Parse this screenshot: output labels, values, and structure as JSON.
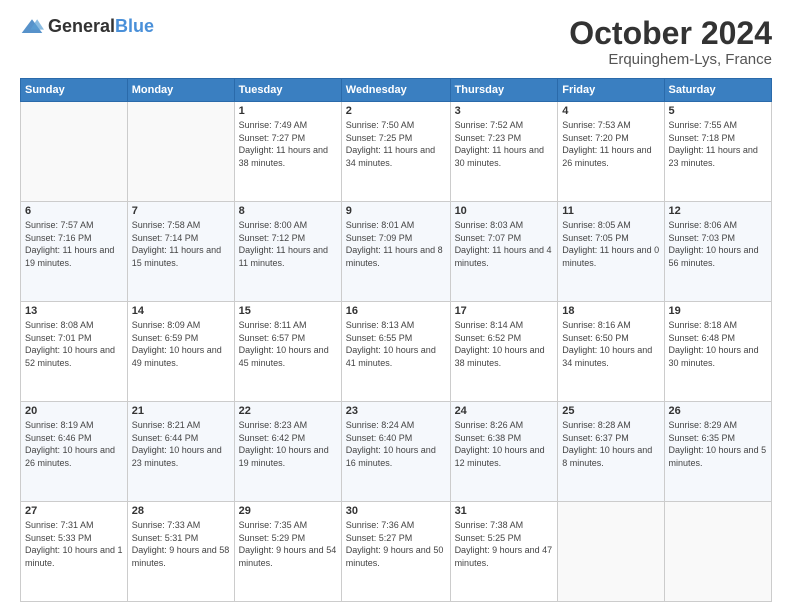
{
  "header": {
    "logo_general": "General",
    "logo_blue": "Blue",
    "month_title": "October 2024",
    "location": "Erquinghem-Lys, France"
  },
  "weekdays": [
    "Sunday",
    "Monday",
    "Tuesday",
    "Wednesday",
    "Thursday",
    "Friday",
    "Saturday"
  ],
  "weeks": [
    [
      {
        "day": "",
        "sunrise": "",
        "sunset": "",
        "daylight": ""
      },
      {
        "day": "",
        "sunrise": "",
        "sunset": "",
        "daylight": ""
      },
      {
        "day": "1",
        "sunrise": "Sunrise: 7:49 AM",
        "sunset": "Sunset: 7:27 PM",
        "daylight": "Daylight: 11 hours and 38 minutes."
      },
      {
        "day": "2",
        "sunrise": "Sunrise: 7:50 AM",
        "sunset": "Sunset: 7:25 PM",
        "daylight": "Daylight: 11 hours and 34 minutes."
      },
      {
        "day": "3",
        "sunrise": "Sunrise: 7:52 AM",
        "sunset": "Sunset: 7:23 PM",
        "daylight": "Daylight: 11 hours and 30 minutes."
      },
      {
        "day": "4",
        "sunrise": "Sunrise: 7:53 AM",
        "sunset": "Sunset: 7:20 PM",
        "daylight": "Daylight: 11 hours and 26 minutes."
      },
      {
        "day": "5",
        "sunrise": "Sunrise: 7:55 AM",
        "sunset": "Sunset: 7:18 PM",
        "daylight": "Daylight: 11 hours and 23 minutes."
      }
    ],
    [
      {
        "day": "6",
        "sunrise": "Sunrise: 7:57 AM",
        "sunset": "Sunset: 7:16 PM",
        "daylight": "Daylight: 11 hours and 19 minutes."
      },
      {
        "day": "7",
        "sunrise": "Sunrise: 7:58 AM",
        "sunset": "Sunset: 7:14 PM",
        "daylight": "Daylight: 11 hours and 15 minutes."
      },
      {
        "day": "8",
        "sunrise": "Sunrise: 8:00 AM",
        "sunset": "Sunset: 7:12 PM",
        "daylight": "Daylight: 11 hours and 11 minutes."
      },
      {
        "day": "9",
        "sunrise": "Sunrise: 8:01 AM",
        "sunset": "Sunset: 7:09 PM",
        "daylight": "Daylight: 11 hours and 8 minutes."
      },
      {
        "day": "10",
        "sunrise": "Sunrise: 8:03 AM",
        "sunset": "Sunset: 7:07 PM",
        "daylight": "Daylight: 11 hours and 4 minutes."
      },
      {
        "day": "11",
        "sunrise": "Sunrise: 8:05 AM",
        "sunset": "Sunset: 7:05 PM",
        "daylight": "Daylight: 11 hours and 0 minutes."
      },
      {
        "day": "12",
        "sunrise": "Sunrise: 8:06 AM",
        "sunset": "Sunset: 7:03 PM",
        "daylight": "Daylight: 10 hours and 56 minutes."
      }
    ],
    [
      {
        "day": "13",
        "sunrise": "Sunrise: 8:08 AM",
        "sunset": "Sunset: 7:01 PM",
        "daylight": "Daylight: 10 hours and 52 minutes."
      },
      {
        "day": "14",
        "sunrise": "Sunrise: 8:09 AM",
        "sunset": "Sunset: 6:59 PM",
        "daylight": "Daylight: 10 hours and 49 minutes."
      },
      {
        "day": "15",
        "sunrise": "Sunrise: 8:11 AM",
        "sunset": "Sunset: 6:57 PM",
        "daylight": "Daylight: 10 hours and 45 minutes."
      },
      {
        "day": "16",
        "sunrise": "Sunrise: 8:13 AM",
        "sunset": "Sunset: 6:55 PM",
        "daylight": "Daylight: 10 hours and 41 minutes."
      },
      {
        "day": "17",
        "sunrise": "Sunrise: 8:14 AM",
        "sunset": "Sunset: 6:52 PM",
        "daylight": "Daylight: 10 hours and 38 minutes."
      },
      {
        "day": "18",
        "sunrise": "Sunrise: 8:16 AM",
        "sunset": "Sunset: 6:50 PM",
        "daylight": "Daylight: 10 hours and 34 minutes."
      },
      {
        "day": "19",
        "sunrise": "Sunrise: 8:18 AM",
        "sunset": "Sunset: 6:48 PM",
        "daylight": "Daylight: 10 hours and 30 minutes."
      }
    ],
    [
      {
        "day": "20",
        "sunrise": "Sunrise: 8:19 AM",
        "sunset": "Sunset: 6:46 PM",
        "daylight": "Daylight: 10 hours and 26 minutes."
      },
      {
        "day": "21",
        "sunrise": "Sunrise: 8:21 AM",
        "sunset": "Sunset: 6:44 PM",
        "daylight": "Daylight: 10 hours and 23 minutes."
      },
      {
        "day": "22",
        "sunrise": "Sunrise: 8:23 AM",
        "sunset": "Sunset: 6:42 PM",
        "daylight": "Daylight: 10 hours and 19 minutes."
      },
      {
        "day": "23",
        "sunrise": "Sunrise: 8:24 AM",
        "sunset": "Sunset: 6:40 PM",
        "daylight": "Daylight: 10 hours and 16 minutes."
      },
      {
        "day": "24",
        "sunrise": "Sunrise: 8:26 AM",
        "sunset": "Sunset: 6:38 PM",
        "daylight": "Daylight: 10 hours and 12 minutes."
      },
      {
        "day": "25",
        "sunrise": "Sunrise: 8:28 AM",
        "sunset": "Sunset: 6:37 PM",
        "daylight": "Daylight: 10 hours and 8 minutes."
      },
      {
        "day": "26",
        "sunrise": "Sunrise: 8:29 AM",
        "sunset": "Sunset: 6:35 PM",
        "daylight": "Daylight: 10 hours and 5 minutes."
      }
    ],
    [
      {
        "day": "27",
        "sunrise": "Sunrise: 7:31 AM",
        "sunset": "Sunset: 5:33 PM",
        "daylight": "Daylight: 10 hours and 1 minute."
      },
      {
        "day": "28",
        "sunrise": "Sunrise: 7:33 AM",
        "sunset": "Sunset: 5:31 PM",
        "daylight": "Daylight: 9 hours and 58 minutes."
      },
      {
        "day": "29",
        "sunrise": "Sunrise: 7:35 AM",
        "sunset": "Sunset: 5:29 PM",
        "daylight": "Daylight: 9 hours and 54 minutes."
      },
      {
        "day": "30",
        "sunrise": "Sunrise: 7:36 AM",
        "sunset": "Sunset: 5:27 PM",
        "daylight": "Daylight: 9 hours and 50 minutes."
      },
      {
        "day": "31",
        "sunrise": "Sunrise: 7:38 AM",
        "sunset": "Sunset: 5:25 PM",
        "daylight": "Daylight: 9 hours and 47 minutes."
      },
      {
        "day": "",
        "sunrise": "",
        "sunset": "",
        "daylight": ""
      },
      {
        "day": "",
        "sunrise": "",
        "sunset": "",
        "daylight": ""
      }
    ]
  ]
}
